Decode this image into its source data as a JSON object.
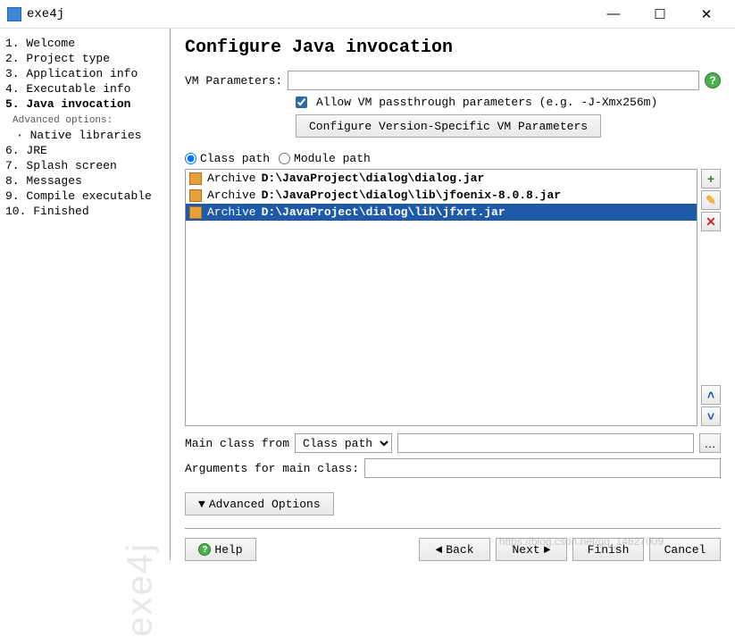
{
  "titlebar": {
    "app_name": "exe4j"
  },
  "sidebar": {
    "items": [
      {
        "num": "1.",
        "label": "Welcome"
      },
      {
        "num": "2.",
        "label": "Project type"
      },
      {
        "num": "3.",
        "label": "Application info"
      },
      {
        "num": "4.",
        "label": "Executable info"
      },
      {
        "num": "5.",
        "label": "Java invocation",
        "selected": true
      },
      {
        "num": "6.",
        "label": "JRE"
      },
      {
        "num": "7.",
        "label": "Splash screen"
      },
      {
        "num": "8.",
        "label": "Messages"
      },
      {
        "num": "9.",
        "label": "Compile executable"
      },
      {
        "num": "10.",
        "label": "Finished"
      }
    ],
    "advanced_header": "Advanced options:",
    "advanced_items": [
      "Native libraries"
    ]
  },
  "page": {
    "title": "Configure Java invocation",
    "vm_label": "VM Parameters:",
    "vm_value": "",
    "allow_passthrough": true,
    "allow_passthrough_label": "Allow VM passthrough parameters (e.g. -J-Xmx256m)",
    "configure_vm_btn": "Configure Version-Specific VM Parameters",
    "radio_classpath": "Class path",
    "radio_modulepath": "Module path",
    "radio_selected": "classpath",
    "classpath": {
      "entries": [
        {
          "kind": "Archive",
          "path": "D:\\JavaProject\\dialog\\dialog.jar",
          "selected": false
        },
        {
          "kind": "Archive",
          "path": "D:\\JavaProject\\dialog\\lib\\jfoenix-8.0.8.jar",
          "selected": false
        },
        {
          "kind": "Archive",
          "path": "D:\\JavaProject\\dialog\\lib\\jfxrt.jar",
          "selected": true
        }
      ]
    },
    "main_class_label": "Main class from",
    "main_class_source": "Class path",
    "main_class_value": "",
    "args_label": "Arguments for main class:",
    "args_value": "",
    "advanced_btn": "Advanced Options"
  },
  "footer": {
    "help": "Help",
    "back": "Back",
    "next": "Next",
    "finish": "Finish",
    "cancel": "Cancel"
  },
  "watermark": "https://blog.csdn.net/qq_14627009"
}
